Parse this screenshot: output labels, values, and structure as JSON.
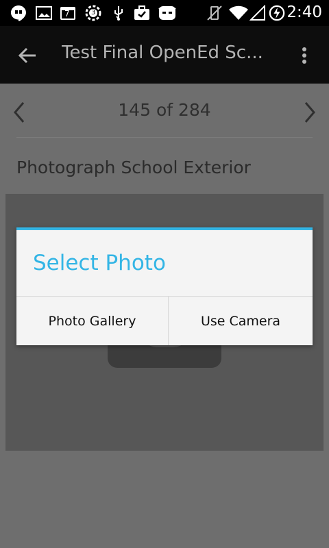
{
  "status_bar": {
    "time": "2:40",
    "left_icons": [
      "hangouts-icon",
      "image-icon",
      "calendar-icon",
      "settings-badge-icon",
      "usb-icon",
      "briefcase-check-icon",
      "cyanogen-icon"
    ],
    "calendar_day": "7",
    "badge_count": "3",
    "right_icons": [
      "vibrate-off-icon",
      "wifi-icon",
      "signal-icon",
      "battery-charging-icon"
    ]
  },
  "action_bar": {
    "title": "Test Final OpenEd Sc...",
    "back_icon": "arrow-left-icon",
    "menu_icon": "overflow-menu-icon"
  },
  "survey": {
    "counter": "145 of 284",
    "question": "Photograph School Exterior",
    "placeholder_icon": "camera-icon"
  },
  "dialog": {
    "title": "Select Photo",
    "buttons": [
      "Photo Gallery",
      "Use Camera"
    ],
    "accent_color": "#33b5e5"
  }
}
